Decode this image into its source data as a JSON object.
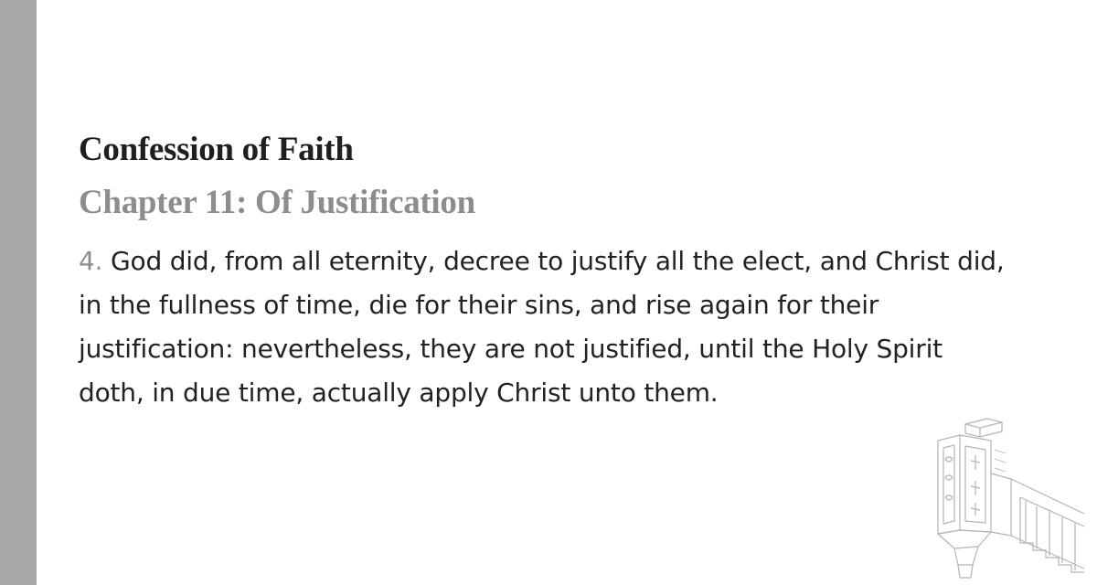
{
  "document": {
    "title": "Confession of Faith",
    "chapter": "Chapter 11: Of Justification",
    "section_number": "4.",
    "section_text": "God did, from all eternity, decree to justify all the elect, and Christ did, in the fullness of time, die for their sins, and rise again for their justification: nevertheless, they are not justified, until the Holy Spirit doth, in due time, actually apply Christ unto them."
  },
  "colors": {
    "sidebar": "#a9a9a9",
    "title": "#1f1f1f",
    "chapter": "#8a8e91",
    "body_text": "#222222",
    "illustration_stroke": "#b5b5b5"
  },
  "illustration": {
    "icon": "pulpit-icon"
  }
}
